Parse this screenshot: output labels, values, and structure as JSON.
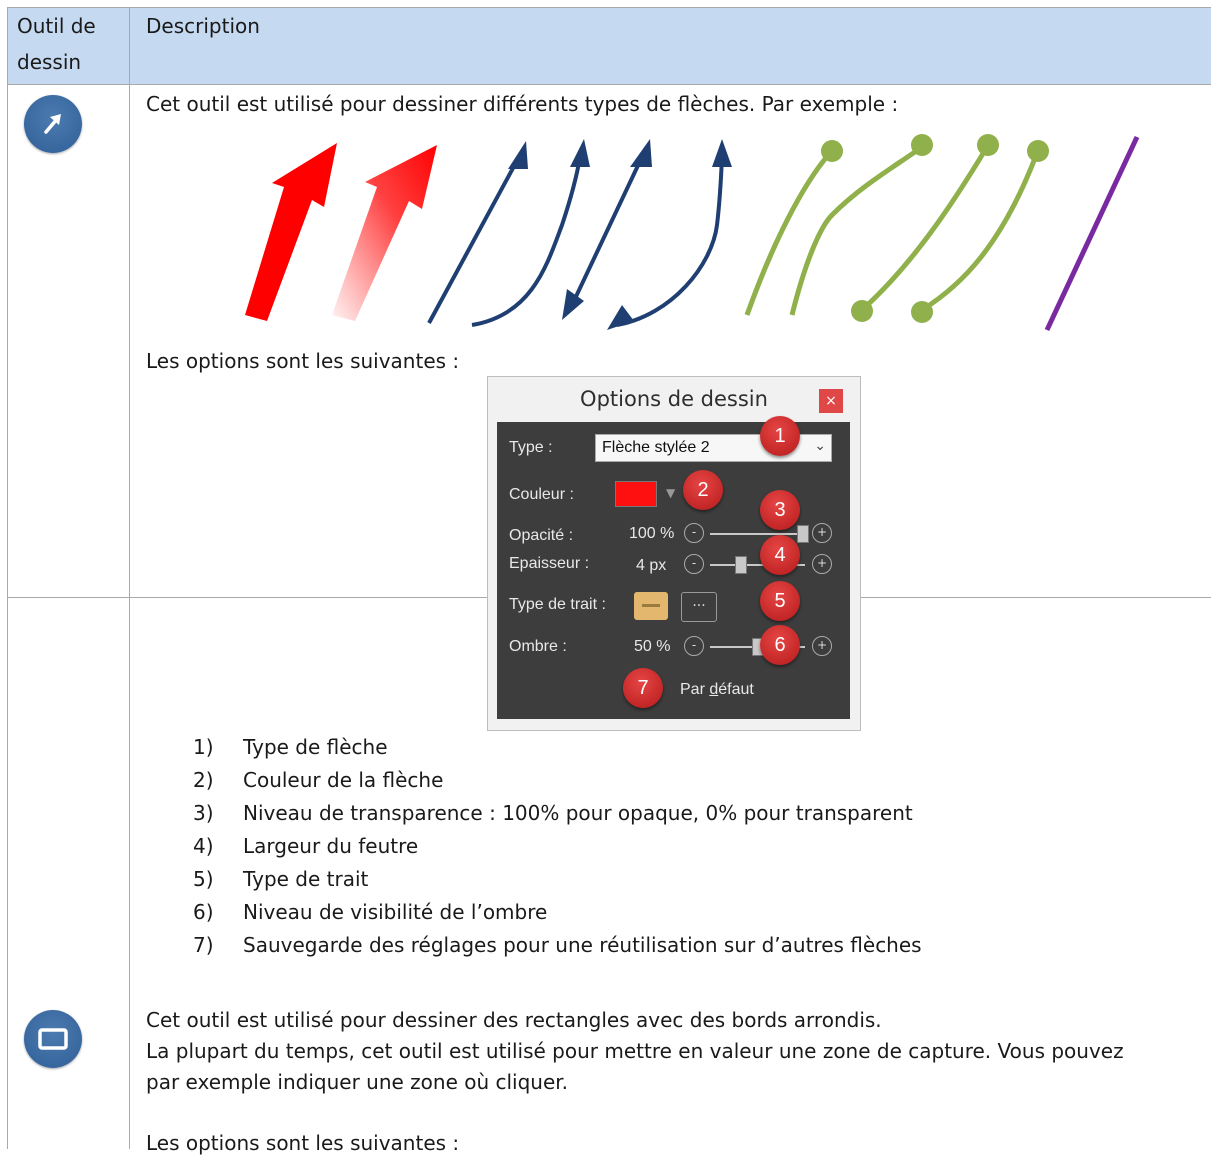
{
  "header": {
    "col1_line1": "Outil de",
    "col1_line2": "dessin",
    "col2": "Description"
  },
  "row1": {
    "icon": "arrow-tool-icon",
    "intro": "Cet outil est utilisé pour dessiner différents types de flèches. Par exemple :",
    "options_intro": "Les options sont les suivantes :",
    "dialog": {
      "title": "Options de dessin",
      "close": "×",
      "type_label": "Type :",
      "type_value": "Flèche stylée 2",
      "color_label": "Couleur :",
      "color_value": "#ff1010",
      "opacity_label": "Opacité :",
      "opacity_value": "100 %",
      "thickness_label": "Epaisseur :",
      "thickness_value": "4 px",
      "line_type_label": "Type de trait :",
      "line_dots": "···",
      "shadow_label": "Ombre :",
      "shadow_value": "50 %",
      "minus": "-",
      "plus": "+",
      "default_label": "Par défaut",
      "badges": [
        "1",
        "2",
        "3",
        "4",
        "5",
        "6",
        "7"
      ]
    },
    "list": [
      {
        "n": "1)",
        "text": "Type de flèche"
      },
      {
        "n": "2)",
        "text": "Couleur de la flèche"
      },
      {
        "n": "3)",
        "text": "Niveau de transparence : 100% pour opaque, 0% pour transparent"
      },
      {
        "n": "4)",
        "text": "Largeur du feutre"
      },
      {
        "n": "5)",
        "text": "Type de trait"
      },
      {
        "n": "6)",
        "text": "Niveau de visibilité de l’ombre"
      },
      {
        "n": "7)",
        "text": "Sauvegarde des réglages pour une réutilisation sur d’autres flèches"
      }
    ]
  },
  "row2": {
    "icon": "rectangle-tool-icon",
    "line1": "Cet outil est utilisé pour dessiner des rectangles avec des bords arrondis.",
    "line2": "La plupart du temps, cet outil est utilisé pour mettre en valeur une zone de capture. Vous pouvez",
    "line3": "par exemple indiquer une zone où cliquer.",
    "options_intro": "Les options sont les suivantes :"
  },
  "colors": {
    "header_bg": "#c5d9f1",
    "icon_blue": "#3a6ea5",
    "arrow_red": "#ff0000",
    "arrow_navy": "#1f3f73",
    "arrow_green": "#8fb04a",
    "arrow_purple": "#7a2aa0",
    "badge_red": "#d42a2a"
  }
}
